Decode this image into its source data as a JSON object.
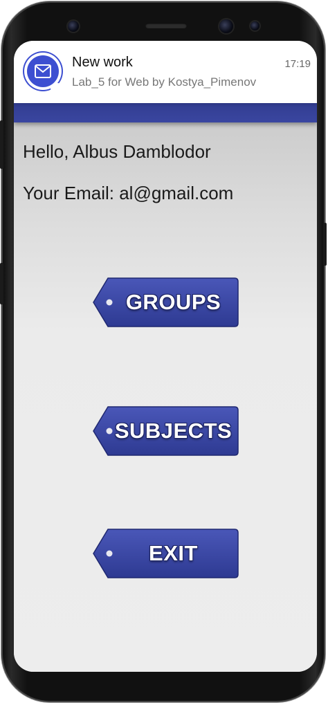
{
  "notification": {
    "title": "New work",
    "text": "Lab_5 for Web by Kostya_Pimenov",
    "time": "17:19",
    "icon": "mail-icon"
  },
  "user": {
    "greeting": "Hello, Albus Damblodor",
    "email": "Your Email: al@gmail.com"
  },
  "buttons": {
    "groups": "GROUPS",
    "subjects": "SUBJECTS",
    "exit": "EXIT"
  },
  "colors": {
    "app_bar": "#2f3a8c",
    "button": "#3a46a0",
    "notification_icon": "#3d4fd1"
  }
}
